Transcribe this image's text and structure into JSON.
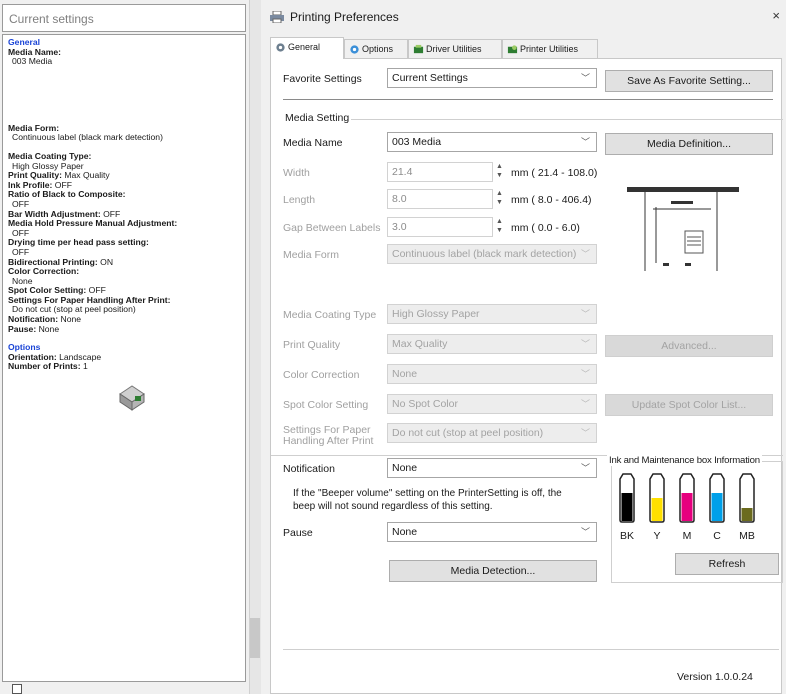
{
  "left": {
    "title": "Current settings",
    "lines": [
      {
        "type": "sec",
        "text": "General"
      },
      {
        "type": "key",
        "text": "Media Name:"
      },
      {
        "type": "val",
        "text": "003 Media"
      },
      {
        "type": "gap-lg"
      },
      {
        "type": "key",
        "text": "Media Form:"
      },
      {
        "type": "val",
        "text": "Continuous label (black mark detection)"
      },
      {
        "type": "gap"
      },
      {
        "type": "key",
        "text": "Media Coating Type:"
      },
      {
        "type": "val",
        "text": "High Glossy Paper"
      },
      {
        "type": "kv",
        "key": "Print Quality:",
        "val": "Max Quality"
      },
      {
        "type": "kv",
        "key": "Ink Profile:",
        "val": "OFF"
      },
      {
        "type": "key",
        "text": "Ratio of Black to Composite:"
      },
      {
        "type": "val",
        "text": "OFF"
      },
      {
        "type": "kv",
        "key": "Bar Width Adjustment:",
        "val": "OFF"
      },
      {
        "type": "key",
        "text": "Media Hold Pressure Manual Adjustment:"
      },
      {
        "type": "val",
        "text": "OFF"
      },
      {
        "type": "key",
        "text": "Drying time per head pass setting:"
      },
      {
        "type": "val",
        "text": "OFF"
      },
      {
        "type": "kv",
        "key": "Bidirectional Printing:",
        "val": "ON"
      },
      {
        "type": "key",
        "text": "Color Correction:"
      },
      {
        "type": "val",
        "text": "None"
      },
      {
        "type": "kv",
        "key": "Spot Color Setting:",
        "val": "OFF"
      },
      {
        "type": "key",
        "text": "Settings For Paper Handling After Print:"
      },
      {
        "type": "val",
        "text": "Do not cut (stop at peel position)"
      },
      {
        "type": "kv",
        "key": "Notification:",
        "val": "None"
      },
      {
        "type": "kv",
        "key": "Pause:",
        "val": "None"
      },
      {
        "type": "gap"
      },
      {
        "type": "sec",
        "text": "Options"
      },
      {
        "type": "kv",
        "key": "Orientation:",
        "val": "Landscape"
      },
      {
        "type": "kv",
        "key": "Number of Prints:",
        "val": "1"
      }
    ]
  },
  "dialog": {
    "title": "Printing Preferences",
    "close": "×",
    "tabs": [
      "General",
      "Options",
      "Driver Utilities",
      "Printer Utilities"
    ],
    "favorite_label": "Favorite Settings",
    "favorite_value": "Current Settings",
    "save_favorite": "Save As Favorite Setting...",
    "media_group": "Media Setting",
    "media_name_label": "Media Name",
    "media_name_value": "003 Media",
    "media_definition": "Media Definition...",
    "width_label": "Width",
    "width_value": "21.4",
    "width_range": "mm ( 21.4 - 108.0)",
    "length_label": "Length",
    "length_value": "8.0",
    "length_range": "mm (  8.0 - 406.4)",
    "gap_label": "Gap Between Labels",
    "gap_value": "3.0",
    "gap_range": "mm (  0.0 -   6.0)",
    "media_form_label": "Media Form",
    "media_form_value": "Continuous label (black mark detection)",
    "coating_label": "Media Coating Type",
    "coating_value": "High Glossy Paper",
    "quality_label": "Print Quality",
    "quality_value": "Max Quality",
    "advanced": "Advanced...",
    "color_corr_label": "Color Correction",
    "color_corr_value": "None",
    "spot_label": "Spot Color Setting",
    "spot_value": "No Spot Color",
    "update_spot": "Update Spot Color List...",
    "paper_handling_label1": "Settings For Paper",
    "paper_handling_label2": "Handling After Print",
    "paper_handling_value": "Do not cut (stop at peel position)",
    "notification_label": "Notification",
    "notification_value": "None",
    "beeper_note1": "If the \"Beeper volume\" setting on the PrinterSetting is off, the",
    "beeper_note2": "beep will not sound regardless of this setting.",
    "pause_label": "Pause",
    "pause_value": "None",
    "media_detection": "Media Detection...",
    "ink_group": "Ink and Maintenance box Information",
    "inks": [
      {
        "label": "BK",
        "color": "#000000",
        "level": 0.55
      },
      {
        "label": "Y",
        "color": "#ffe000",
        "level": 0.45
      },
      {
        "label": "M",
        "color": "#e6007e",
        "level": 0.55
      },
      {
        "label": "C",
        "color": "#00a0e9",
        "level": 0.55
      },
      {
        "label": "MB",
        "color": "#6b6b1e",
        "level": 0.25
      }
    ],
    "refresh": "Refresh",
    "version": "Version 1.0.0.24"
  }
}
